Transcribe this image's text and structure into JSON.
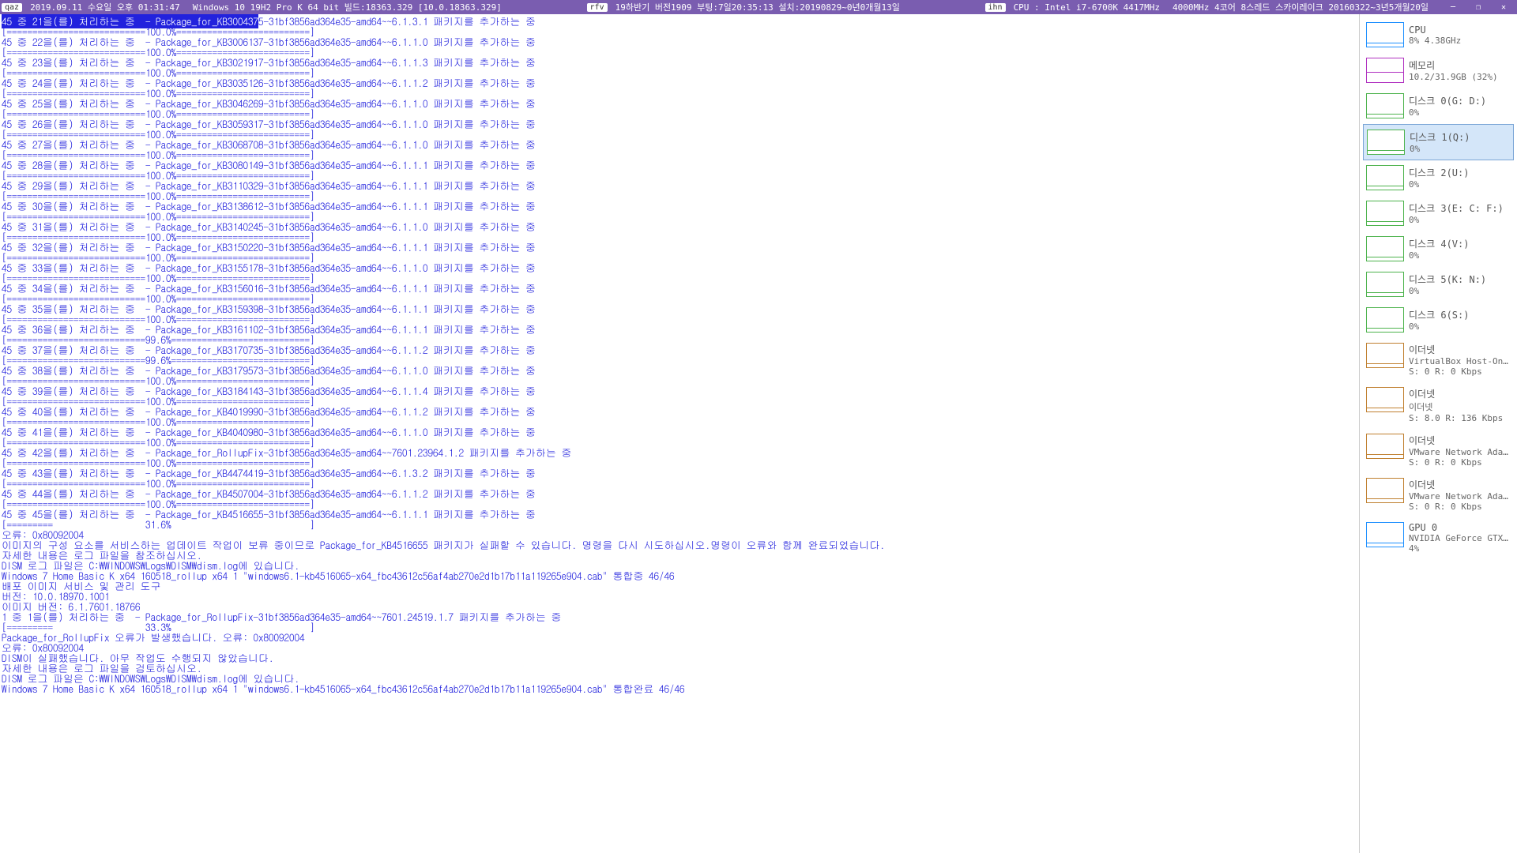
{
  "titlebar": {
    "qaz_label": "qaz",
    "datetime": "2019.09.11 수요일 오후 01:31:47",
    "os_info": "Windows 10 19H2 Pro K 64 bit 빌드:18363.329 [10.0.18363.329]",
    "rfv_label": "rfv",
    "boot_info": "19하반기 버전1909 부팅:7일20:35:13 설치:20190829~0년0개월13일",
    "ihn_label": "ihn",
    "cpu_info": "CPU : Intel i7-6700K 4417MHz",
    "hw_info": "4000MHz 4코어 8스레드 스카이레이크 20160322~3년5개월20일"
  },
  "console_lines": [
    "45 중 21을(를) 처리하는 중  - Package_for_KB3004375-31bf3856ad364e35-amd64~~6.1.3.1 패키지를 추가하는 중",
    "[===========================100.0%==========================]",
    "45 중 22을(를) 처리하는 중  - Package_for_KB3006137-31bf3856ad364e35-amd64~~6.1.1.0 패키지를 추가하는 중",
    "[===========================100.0%==========================]",
    "45 중 23을(를) 처리하는 중  - Package_for_KB3021917-31bf3856ad364e35-amd64~~6.1.1.3 패키지를 추가하는 중",
    "[===========================100.0%==========================]",
    "45 중 24을(를) 처리하는 중  - Package_for_KB3035126-31bf3856ad364e35-amd64~~6.1.1.2 패키지를 추가하는 중",
    "[===========================100.0%==========================]",
    "45 중 25을(를) 처리하는 중  - Package_for_KB3046269-31bf3856ad364e35-amd64~~6.1.1.0 패키지를 추가하는 중",
    "[===========================100.0%==========================]",
    "45 중 26을(를) 처리하는 중  - Package_for_KB3059317-31bf3856ad364e35-amd64~~6.1.1.0 패키지를 추가하는 중",
    "[===========================100.0%==========================]",
    "45 중 27을(를) 처리하는 중  - Package_for_KB3068708-31bf3856ad364e35-amd64~~6.1.1.0 패키지를 추가하는 중",
    "[===========================100.0%==========================]",
    "45 중 28을(를) 처리하는 중  - Package_for_KB3080149-31bf3856ad364e35-amd64~~6.1.1.1 패키지를 추가하는 중",
    "[===========================100.0%==========================]",
    "45 중 29을(를) 처리하는 중  - Package_for_KB3110329-31bf3856ad364e35-amd64~~6.1.1.1 패키지를 추가하는 중",
    "[===========================100.0%==========================]",
    "45 중 30을(를) 처리하는 중  - Package_for_KB3138612-31bf3856ad364e35-amd64~~6.1.1.1 패키지를 추가하는 중",
    "[===========================100.0%==========================]",
    "45 중 31을(를) 처리하는 중  - Package_for_KB3140245-31bf3856ad364e35-amd64~~6.1.1.0 패키지를 추가하는 중",
    "[===========================100.0%==========================]",
    "45 중 32을(를) 처리하는 중  - Package_for_KB3150220-31bf3856ad364e35-amd64~~6.1.1.1 패키지를 추가하는 중",
    "[===========================100.0%==========================]",
    "45 중 33을(를) 처리하는 중  - Package_for_KB3155178-31bf3856ad364e35-amd64~~6.1.1.0 패키지를 추가하는 중",
    "[===========================100.0%==========================]",
    "45 중 34을(를) 처리하는 중  - Package_for_KB3156016-31bf3856ad364e35-amd64~~6.1.1.1 패키지를 추가하는 중",
    "[===========================100.0%==========================]",
    "45 중 35을(를) 처리하는 중  - Package_for_KB3159398-31bf3856ad364e35-amd64~~6.1.1.1 패키지를 추가하는 중",
    "[===========================100.0%==========================]",
    "45 중 36을(를) 처리하는 중  - Package_for_KB3161102-31bf3856ad364e35-amd64~~6.1.1.1 패키지를 추가하는 중",
    "[===========================99.6%===========================]",
    "45 중 37을(를) 처리하는 중  - Package_for_KB3170735-31bf3856ad364e35-amd64~~6.1.1.2 패키지를 추가하는 중",
    "[===========================99.6%===========================]",
    "45 중 38을(를) 처리하는 중  - Package_for_KB3179573-31bf3856ad364e35-amd64~~6.1.1.0 패키지를 추가하는 중",
    "[===========================100.0%==========================]",
    "45 중 39을(를) 처리하는 중  - Package_for_KB3184143-31bf3856ad364e35-amd64~~6.1.1.4 패키지를 추가하는 중",
    "[===========================100.0%==========================]",
    "45 중 40을(를) 처리하는 중  - Package_for_KB4019990-31bf3856ad364e35-amd64~~6.1.1.2 패키지를 추가하는 중",
    "[===========================100.0%==========================]",
    "45 중 41을(를) 처리하는 중  - Package_for_KB4040980-31bf3856ad364e35-amd64~~6.1.1.0 패키지를 추가하는 중",
    "[===========================100.0%==========================]",
    "45 중 42을(를) 처리하는 중  - Package_for_RollupFix-31bf3856ad364e35-amd64~~7601.23964.1.2 패키지를 추가하는 중",
    "[===========================100.0%==========================]",
    "45 중 43을(를) 처리하는 중  - Package_for_KB4474419-31bf3856ad364e35-amd64~~6.1.3.2 패키지를 추가하는 중",
    "[===========================100.0%==========================]",
    "45 중 44을(를) 처리하는 중  - Package_for_KB4507004-31bf3856ad364e35-amd64~~6.1.1.2 패키지를 추가하는 중",
    "[===========================100.0%==========================]",
    "45 중 45을(를) 처리하는 중  - Package_for_KB4516655-31bf3856ad364e35-amd64~~6.1.1.1 패키지를 추가하는 중",
    "[=========                  31.6%                           ]",
    "",
    "오류: 0x80092004",
    "",
    "이미지의 구성 요소를 서비스하는 업데이트 작업이 보류 중이므로 Package_for_KB4516655 패키지가 실패할 수 있습니다. 명령을 다시 시도하십시오.명령이 오류와 함께 완료되었습니다.",
    "자세한 내용은 로그 파일을 참조하십시오.",
    "",
    "DISM 로그 파일은 C:\\WINDOWS\\Logs\\DISM\\dism.log에 있습니다.",
    "",
    "Windows 7 Home Basic K x64 160518_rollup x64 1 \"windows6.1-kb4516065-x64_fbc43612c56af4ab270e2d1b17b11a119265e904.cab\" 통합중 46/46",
    "",
    "배포 이미지 서비스 및 관리 도구",
    "버전: 10.0.18970.1001",
    "",
    "이미지 버전: 6.1.7601.18766",
    "",
    "1 중 1을(를) 처리하는 중  - Package_for_RollupFix-31bf3856ad364e35-amd64~~7601.24519.1.7 패키지를 추가하는 중",
    "[=========                  33.3%                           ]",
    "Package_for_RollupFix 오류가 발생했습니다. 오류: 0x80092004",
    "",
    "오류: 0x80092004",
    "",
    "DISM이 실패했습니다. 아무 작업도 수행되지 않았습니다.",
    "자세한 내용은 로그 파일을 검토하십시오.",
    "",
    "DISM 로그 파일은 C:\\WINDOWS\\Logs\\DISM\\dism.log에 있습니다.",
    "",
    "Windows 7 Home Basic K x64 160518_rollup x64 1 \"windows6.1-kb4516065-x64_fbc43612c56af4ab270e2d1b17b11a119265e904.cab\" 통합완료 46/46"
  ],
  "sidebar": [
    {
      "title": "CPU",
      "val": "8%  4.38GHz",
      "cls": "cpu",
      "sel": false
    },
    {
      "title": "메모리",
      "val": "10.2/31.9GB (32%)",
      "cls": "mem",
      "sel": false
    },
    {
      "title": "디스크 0(G: D:)",
      "val": "0%",
      "cls": "disk",
      "sel": false
    },
    {
      "title": "디스크 1(Q:)",
      "val": "0%",
      "cls": "disk",
      "sel": true
    },
    {
      "title": "디스크 2(U:)",
      "val": "0%",
      "cls": "disk",
      "sel": false
    },
    {
      "title": "디스크 3(E: C: F:)",
      "val": "0%",
      "cls": "disk",
      "sel": false
    },
    {
      "title": "디스크 4(V:)",
      "val": "0%",
      "cls": "disk",
      "sel": false
    },
    {
      "title": "디스크 5(K: N:)",
      "val": "0%",
      "cls": "disk",
      "sel": false
    },
    {
      "title": "디스크 6(S:)",
      "val": "0%",
      "cls": "disk",
      "sel": false
    },
    {
      "title": "이더넷",
      "val": "VirtualBox Host-Only ..",
      "val2": "S: 0 R: 0 Kbps",
      "cls": "net",
      "sel": false
    },
    {
      "title": "이더넷",
      "val": "이더넷",
      "val2": "S: 8.0 R: 136 Kbps",
      "cls": "net",
      "sel": false
    },
    {
      "title": "이더넷",
      "val": "VMware Network Ada..",
      "val2": "S: 0 R: 0 Kbps",
      "cls": "net",
      "sel": false
    },
    {
      "title": "이더넷",
      "val": "VMware Network Ada..",
      "val2": "S: 0 R: 0 Kbps",
      "cls": "net",
      "sel": false
    },
    {
      "title": "GPU 0",
      "val": "NVIDIA GeForce GTX ..",
      "val2": "4%",
      "cls": "gpu",
      "sel": false
    }
  ]
}
